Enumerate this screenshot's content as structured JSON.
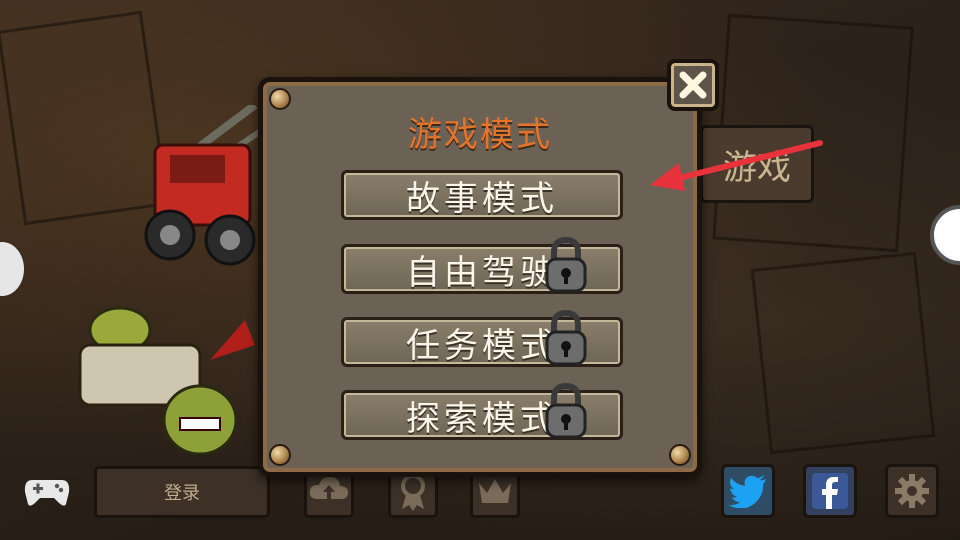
{
  "dialog": {
    "title": "游戏模式",
    "modes": [
      {
        "label": "故事模式",
        "locked": false
      },
      {
        "label": "自由驾驶",
        "locked": true
      },
      {
        "label": "任务模式",
        "locked": true
      },
      {
        "label": "探索模式",
        "locked": true
      }
    ],
    "close_icon": "close-icon"
  },
  "background": {
    "side_button_label": "游戏"
  },
  "bottom_bar": {
    "login_label": "登录",
    "icons": [
      "cloud-upload-icon",
      "award-icon",
      "crown-icon"
    ]
  },
  "social": {
    "twitter_icon": "twitter-icon",
    "facebook_icon": "facebook-icon",
    "settings_icon": "gear-icon"
  },
  "colors": {
    "title": "#e6732a",
    "arrow": "#e8323c",
    "twitter": "#1da1f2",
    "facebook": "#3b5998"
  }
}
